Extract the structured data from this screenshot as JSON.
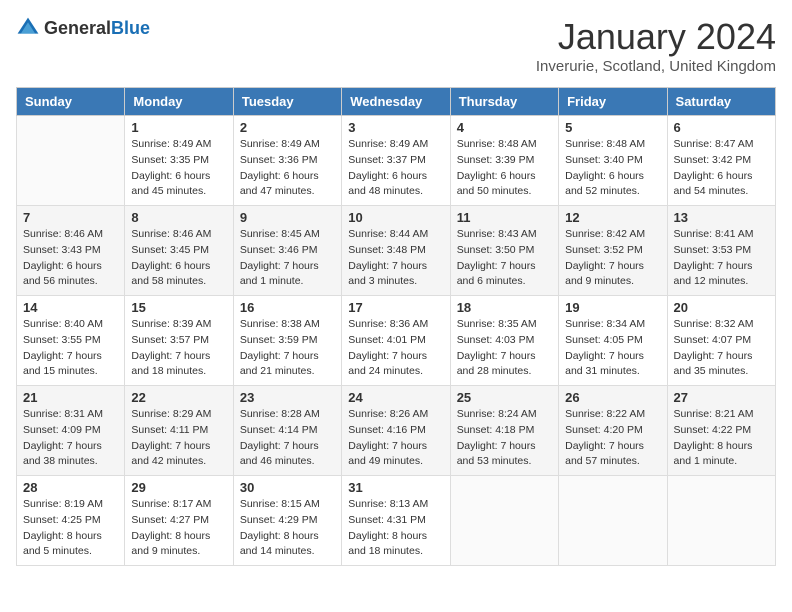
{
  "header": {
    "logo_general": "General",
    "logo_blue": "Blue",
    "month_year": "January 2024",
    "location": "Inverurie, Scotland, United Kingdom"
  },
  "weekdays": [
    "Sunday",
    "Monday",
    "Tuesday",
    "Wednesday",
    "Thursday",
    "Friday",
    "Saturday"
  ],
  "weeks": [
    [
      {
        "day": "",
        "sunrise": "",
        "sunset": "",
        "daylight": ""
      },
      {
        "day": "1",
        "sunrise": "Sunrise: 8:49 AM",
        "sunset": "Sunset: 3:35 PM",
        "daylight": "Daylight: 6 hours and 45 minutes."
      },
      {
        "day": "2",
        "sunrise": "Sunrise: 8:49 AM",
        "sunset": "Sunset: 3:36 PM",
        "daylight": "Daylight: 6 hours and 47 minutes."
      },
      {
        "day": "3",
        "sunrise": "Sunrise: 8:49 AM",
        "sunset": "Sunset: 3:37 PM",
        "daylight": "Daylight: 6 hours and 48 minutes."
      },
      {
        "day": "4",
        "sunrise": "Sunrise: 8:48 AM",
        "sunset": "Sunset: 3:39 PM",
        "daylight": "Daylight: 6 hours and 50 minutes."
      },
      {
        "day": "5",
        "sunrise": "Sunrise: 8:48 AM",
        "sunset": "Sunset: 3:40 PM",
        "daylight": "Daylight: 6 hours and 52 minutes."
      },
      {
        "day": "6",
        "sunrise": "Sunrise: 8:47 AM",
        "sunset": "Sunset: 3:42 PM",
        "daylight": "Daylight: 6 hours and 54 minutes."
      }
    ],
    [
      {
        "day": "7",
        "sunrise": "Sunrise: 8:46 AM",
        "sunset": "Sunset: 3:43 PM",
        "daylight": "Daylight: 6 hours and 56 minutes."
      },
      {
        "day": "8",
        "sunrise": "Sunrise: 8:46 AM",
        "sunset": "Sunset: 3:45 PM",
        "daylight": "Daylight: 6 hours and 58 minutes."
      },
      {
        "day": "9",
        "sunrise": "Sunrise: 8:45 AM",
        "sunset": "Sunset: 3:46 PM",
        "daylight": "Daylight: 7 hours and 1 minute."
      },
      {
        "day": "10",
        "sunrise": "Sunrise: 8:44 AM",
        "sunset": "Sunset: 3:48 PM",
        "daylight": "Daylight: 7 hours and 3 minutes."
      },
      {
        "day": "11",
        "sunrise": "Sunrise: 8:43 AM",
        "sunset": "Sunset: 3:50 PM",
        "daylight": "Daylight: 7 hours and 6 minutes."
      },
      {
        "day": "12",
        "sunrise": "Sunrise: 8:42 AM",
        "sunset": "Sunset: 3:52 PM",
        "daylight": "Daylight: 7 hours and 9 minutes."
      },
      {
        "day": "13",
        "sunrise": "Sunrise: 8:41 AM",
        "sunset": "Sunset: 3:53 PM",
        "daylight": "Daylight: 7 hours and 12 minutes."
      }
    ],
    [
      {
        "day": "14",
        "sunrise": "Sunrise: 8:40 AM",
        "sunset": "Sunset: 3:55 PM",
        "daylight": "Daylight: 7 hours and 15 minutes."
      },
      {
        "day": "15",
        "sunrise": "Sunrise: 8:39 AM",
        "sunset": "Sunset: 3:57 PM",
        "daylight": "Daylight: 7 hours and 18 minutes."
      },
      {
        "day": "16",
        "sunrise": "Sunrise: 8:38 AM",
        "sunset": "Sunset: 3:59 PM",
        "daylight": "Daylight: 7 hours and 21 minutes."
      },
      {
        "day": "17",
        "sunrise": "Sunrise: 8:36 AM",
        "sunset": "Sunset: 4:01 PM",
        "daylight": "Daylight: 7 hours and 24 minutes."
      },
      {
        "day": "18",
        "sunrise": "Sunrise: 8:35 AM",
        "sunset": "Sunset: 4:03 PM",
        "daylight": "Daylight: 7 hours and 28 minutes."
      },
      {
        "day": "19",
        "sunrise": "Sunrise: 8:34 AM",
        "sunset": "Sunset: 4:05 PM",
        "daylight": "Daylight: 7 hours and 31 minutes."
      },
      {
        "day": "20",
        "sunrise": "Sunrise: 8:32 AM",
        "sunset": "Sunset: 4:07 PM",
        "daylight": "Daylight: 7 hours and 35 minutes."
      }
    ],
    [
      {
        "day": "21",
        "sunrise": "Sunrise: 8:31 AM",
        "sunset": "Sunset: 4:09 PM",
        "daylight": "Daylight: 7 hours and 38 minutes."
      },
      {
        "day": "22",
        "sunrise": "Sunrise: 8:29 AM",
        "sunset": "Sunset: 4:11 PM",
        "daylight": "Daylight: 7 hours and 42 minutes."
      },
      {
        "day": "23",
        "sunrise": "Sunrise: 8:28 AM",
        "sunset": "Sunset: 4:14 PM",
        "daylight": "Daylight: 7 hours and 46 minutes."
      },
      {
        "day": "24",
        "sunrise": "Sunrise: 8:26 AM",
        "sunset": "Sunset: 4:16 PM",
        "daylight": "Daylight: 7 hours and 49 minutes."
      },
      {
        "day": "25",
        "sunrise": "Sunrise: 8:24 AM",
        "sunset": "Sunset: 4:18 PM",
        "daylight": "Daylight: 7 hours and 53 minutes."
      },
      {
        "day": "26",
        "sunrise": "Sunrise: 8:22 AM",
        "sunset": "Sunset: 4:20 PM",
        "daylight": "Daylight: 7 hours and 57 minutes."
      },
      {
        "day": "27",
        "sunrise": "Sunrise: 8:21 AM",
        "sunset": "Sunset: 4:22 PM",
        "daylight": "Daylight: 8 hours and 1 minute."
      }
    ],
    [
      {
        "day": "28",
        "sunrise": "Sunrise: 8:19 AM",
        "sunset": "Sunset: 4:25 PM",
        "daylight": "Daylight: 8 hours and 5 minutes."
      },
      {
        "day": "29",
        "sunrise": "Sunrise: 8:17 AM",
        "sunset": "Sunset: 4:27 PM",
        "daylight": "Daylight: 8 hours and 9 minutes."
      },
      {
        "day": "30",
        "sunrise": "Sunrise: 8:15 AM",
        "sunset": "Sunset: 4:29 PM",
        "daylight": "Daylight: 8 hours and 14 minutes."
      },
      {
        "day": "31",
        "sunrise": "Sunrise: 8:13 AM",
        "sunset": "Sunset: 4:31 PM",
        "daylight": "Daylight: 8 hours and 18 minutes."
      },
      {
        "day": "",
        "sunrise": "",
        "sunset": "",
        "daylight": ""
      },
      {
        "day": "",
        "sunrise": "",
        "sunset": "",
        "daylight": ""
      },
      {
        "day": "",
        "sunrise": "",
        "sunset": "",
        "daylight": ""
      }
    ]
  ]
}
